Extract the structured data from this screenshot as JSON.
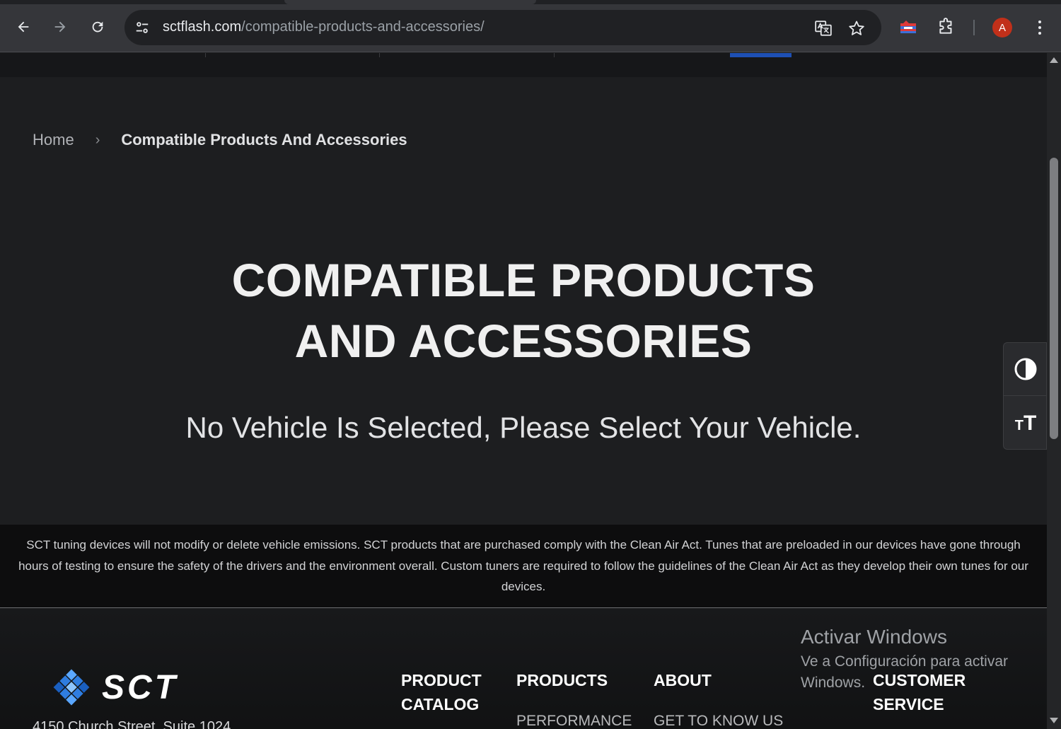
{
  "browser": {
    "url_host": "sctflash.com",
    "url_path": "/compatible-products-and-accessories/",
    "avatar_letter": "A"
  },
  "breadcrumb": {
    "home": "Home",
    "separator": "›",
    "current": "Compatible Products And Accessories"
  },
  "main": {
    "title_line1": "COMPATIBLE PRODUCTS",
    "title_line2": "AND ACCESSORIES",
    "message": "No Vehicle Is Selected, Please Select Your Vehicle."
  },
  "disclaimer": {
    "text": "SCT tuning devices will not modify or delete vehicle emissions. SCT products that are purchased comply with the Clean Air Act. Tunes that are preloaded in our devices have gone through hours of testing to ensure the safety of the drivers and the environment overall. Custom tuners are required to follow the guidelines of the Clean Air Act as they develop their own tunes for our devices."
  },
  "footer": {
    "logo_text": "SCT",
    "address": "4150 Church Street, Suite 1024",
    "columns": [
      {
        "heading_line1": "PRODUCT",
        "heading_line2": "CATALOG"
      },
      {
        "heading_line1": "PRODUCTS",
        "link": "PERFORMANCE"
      },
      {
        "heading_line1": "ABOUT",
        "link": "GET TO KNOW US"
      },
      {
        "heading_line1": "CUSTOMER",
        "heading_line2": "SERVICE"
      }
    ]
  },
  "windows_watermark": {
    "title": "Activar Windows",
    "subtitle": "Ve a Configuración para activar Windows."
  },
  "colors": {
    "page_bg": "#1d1e20",
    "accent_blue": "#1e50b4",
    "avatar_bg": "#c1301a"
  }
}
